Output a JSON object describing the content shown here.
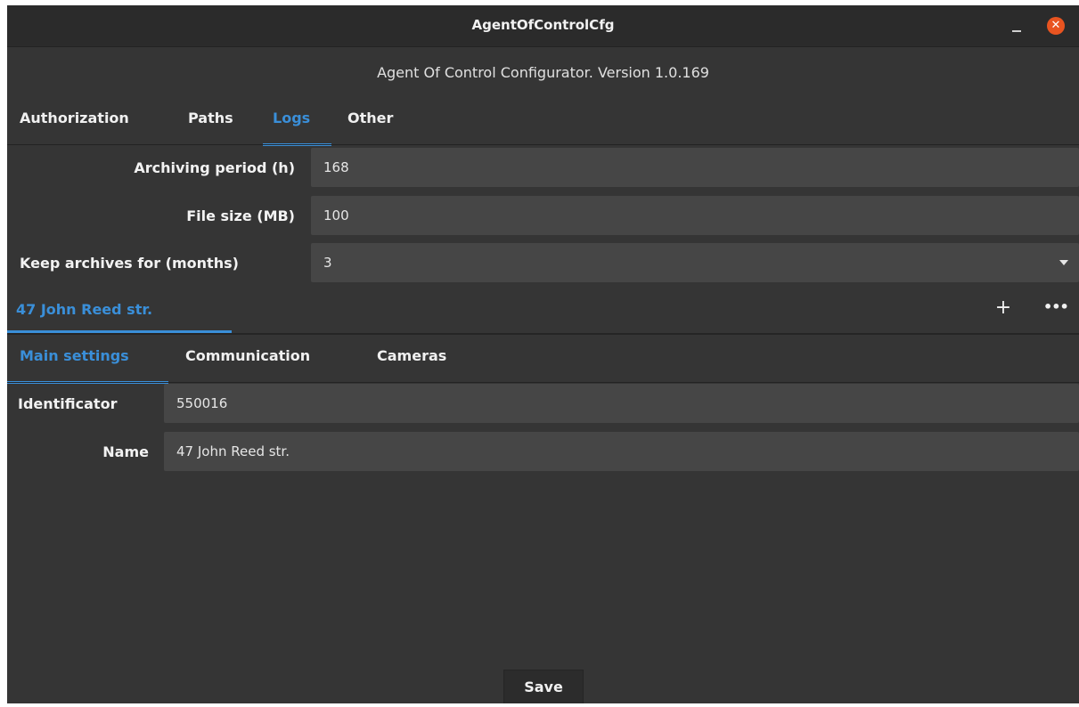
{
  "window": {
    "title": "AgentOfControlCfg",
    "minimize_label": "",
    "close_label": "✕"
  },
  "header": {
    "subtitle": "Agent Of Control Configurator. Version 1.0.169"
  },
  "main_tabs": [
    {
      "label": "Authorization",
      "active": false
    },
    {
      "label": "Paths",
      "active": false
    },
    {
      "label": "Logs",
      "active": true
    },
    {
      "label": "Other",
      "active": false
    }
  ],
  "logs": {
    "archiving_period_label": "Archiving period (h)",
    "archiving_period_value": "168",
    "file_size_label": "File size (MB)",
    "file_size_value": "100",
    "keep_archives_label": "Keep archives for (months)",
    "keep_archives_value": "3"
  },
  "object_group": {
    "title": "47 John Reed str.",
    "add_icon": "plus-icon",
    "more_icon": "more-icon"
  },
  "sub_tabs": [
    {
      "label": "Main settings",
      "active": true
    },
    {
      "label": "Communication",
      "active": false
    },
    {
      "label": "Cameras",
      "active": false
    }
  ],
  "main_settings": {
    "identificator_label": "Identificator",
    "identificator_value": "550016",
    "name_label": "Name",
    "name_value": "47 John Reed str."
  },
  "footer": {
    "save_label": "Save"
  },
  "colors": {
    "accent": "#3a8fd9",
    "background": "#353535",
    "field": "#464646",
    "close": "#e95420"
  }
}
